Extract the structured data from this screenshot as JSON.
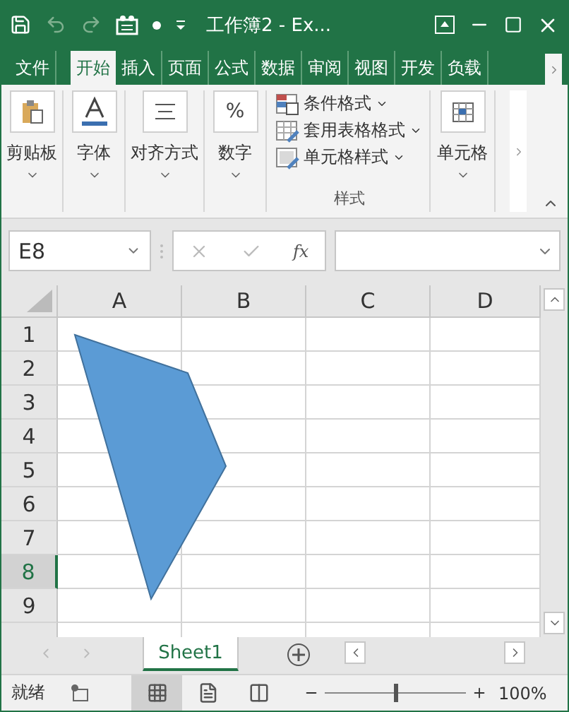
{
  "window": {
    "title": "工作簿2 - Ex..."
  },
  "quick_access": [
    {
      "kind": "save",
      "disabled": false
    },
    {
      "kind": "undo",
      "disabled": true
    },
    {
      "kind": "redo",
      "disabled": true
    },
    {
      "kind": "form",
      "disabled": false
    },
    {
      "kind": "dot",
      "disabled": false
    },
    {
      "kind": "customize",
      "disabled": false
    }
  ],
  "tabs": [
    {
      "label": "文件",
      "selected": false
    },
    {
      "label": "开始",
      "selected": true
    },
    {
      "label": "插入",
      "selected": false
    },
    {
      "label": "页面",
      "selected": false
    },
    {
      "label": "公式",
      "selected": false
    },
    {
      "label": "数据",
      "selected": false
    },
    {
      "label": "审阅",
      "selected": false
    },
    {
      "label": "视图",
      "selected": false
    },
    {
      "label": "开发",
      "selected": false
    },
    {
      "label": "负载",
      "selected": false
    }
  ],
  "ribbon": {
    "groups": [
      {
        "kind": "clipboard",
        "label": "剪贴板"
      },
      {
        "kind": "font",
        "label": "字体"
      },
      {
        "kind": "align",
        "label": "对齐方式"
      },
      {
        "kind": "number",
        "label": "数字",
        "icon_text": "%"
      }
    ],
    "styles": {
      "items": [
        {
          "kind": "conditional",
          "label": "条件格式"
        },
        {
          "kind": "table",
          "label": "套用表格格式"
        },
        {
          "kind": "cell",
          "label": "单元格样式"
        }
      ],
      "label": "样式"
    },
    "cells": {
      "label": "单元格"
    }
  },
  "formula_bar": {
    "name_box": "E8",
    "fx": "fx"
  },
  "sheet": {
    "columns": [
      {
        "label": "A",
        "selected": false
      },
      {
        "label": "B",
        "selected": false
      },
      {
        "label": "C",
        "selected": false
      },
      {
        "label": "D",
        "selected": false
      }
    ],
    "rows": [
      {
        "label": "1",
        "selected": false
      },
      {
        "label": "2",
        "selected": false
      },
      {
        "label": "3",
        "selected": false
      },
      {
        "label": "4",
        "selected": false
      },
      {
        "label": "5",
        "selected": false
      },
      {
        "label": "6",
        "selected": false
      },
      {
        "label": "7",
        "selected": false
      },
      {
        "label": "8",
        "selected": true
      },
      {
        "label": "9",
        "selected": false
      }
    ],
    "shape": {
      "kind": "polygon",
      "color": "#5b9bd5"
    }
  },
  "sheet_tabs": [
    {
      "label": "Sheet1",
      "selected": true
    }
  ],
  "status_bar": {
    "status": "就绪",
    "views": [
      {
        "kind": "normal",
        "selected": true
      },
      {
        "kind": "layout",
        "selected": false
      },
      {
        "kind": "pagebreak",
        "selected": false
      }
    ],
    "zoom": {
      "level": 0.5
    },
    "zoom_label": "100%"
  }
}
